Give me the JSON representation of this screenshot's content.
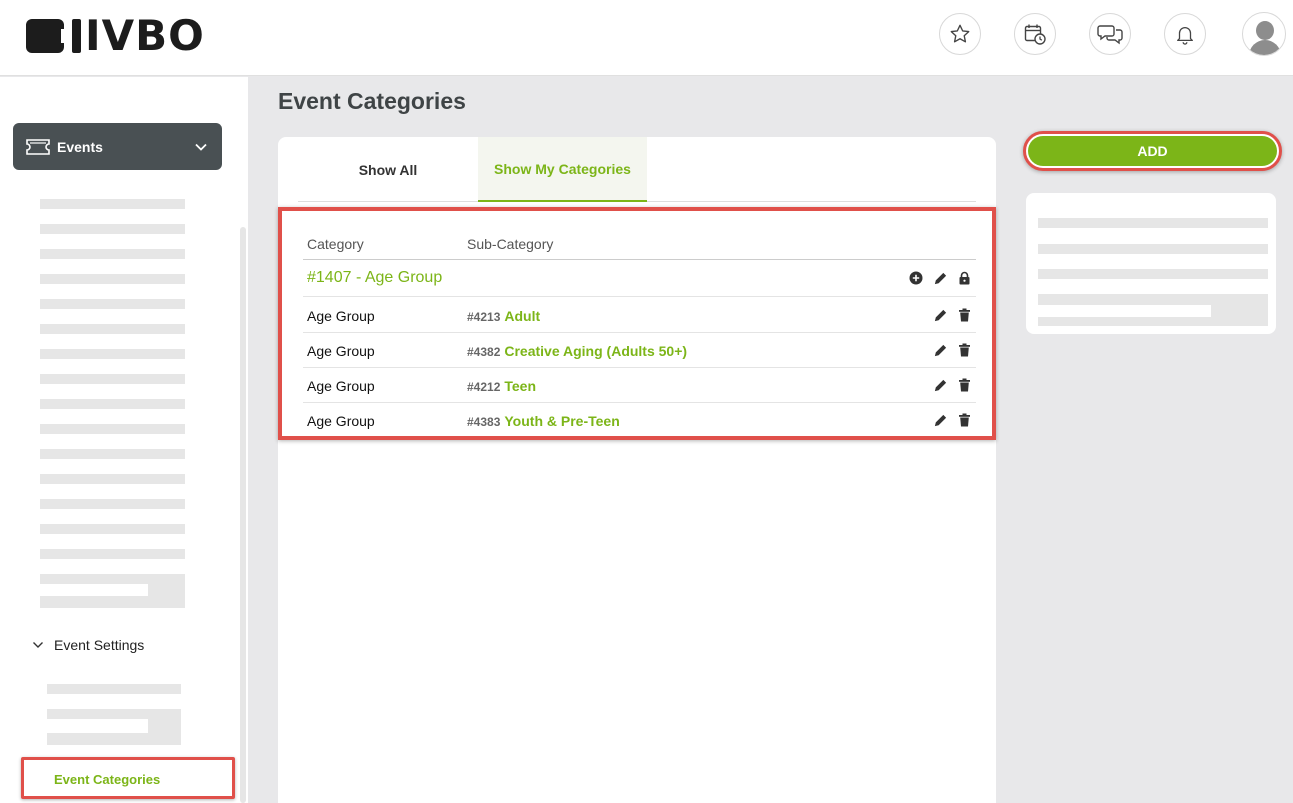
{
  "header": {
    "logo_text": "IVBO",
    "icons": [
      "star-icon",
      "calendar-clock-icon",
      "chat-bubbles-icon",
      "bell-icon",
      "user-avatar"
    ]
  },
  "sidebar": {
    "events_label": "Events",
    "settings_label": "Event Settings",
    "active_item_label": "Event Categories"
  },
  "main": {
    "page_title": "Event Categories",
    "tabs": [
      {
        "label": "Show All",
        "active": false
      },
      {
        "label": "Show My Categories",
        "active": true
      }
    ],
    "table": {
      "columns": [
        "Category",
        "Sub-Category"
      ],
      "group_title": "#1407 - Age Group",
      "rows": [
        {
          "category": "Age Group",
          "sub_id": "#4213",
          "sub_name": "Adult"
        },
        {
          "category": "Age Group",
          "sub_id": "#4382",
          "sub_name": "Creative Aging (Adults 50+)"
        },
        {
          "category": "Age Group",
          "sub_id": "#4212",
          "sub_name": "Teen"
        },
        {
          "category": "Age Group",
          "sub_id": "#4383",
          "sub_name": "Youth & Pre-Teen"
        }
      ]
    }
  },
  "right_panel": {
    "add_label": "ADD"
  },
  "colors": {
    "accent_green": "#7cb518",
    "highlight_red": "#e0504a",
    "sidebar_button": "#495053"
  }
}
